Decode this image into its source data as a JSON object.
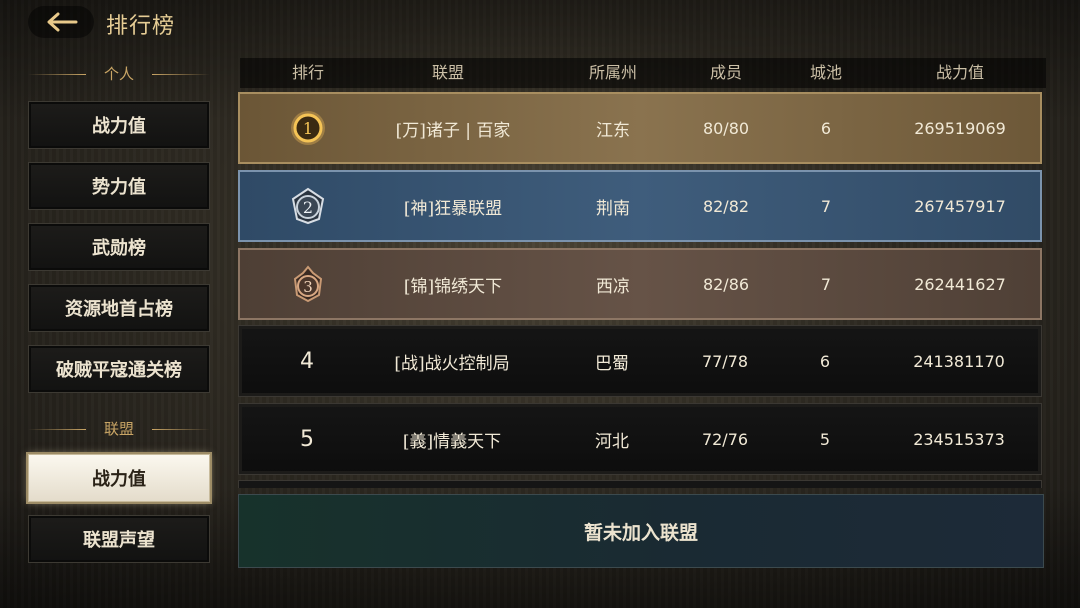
{
  "header": {
    "title": "排行榜"
  },
  "sidebar": {
    "personal_label": "个人",
    "personal_items": [
      "战力值",
      "势力值",
      "武勋榜",
      "资源地首占榜",
      "破贼平寇通关榜"
    ],
    "alliance_label": "联盟",
    "alliance_items": [
      "战力值",
      "联盟声望"
    ],
    "active_item": "联盟-战力值"
  },
  "table": {
    "headers": [
      "排行",
      "联盟",
      "所属州",
      "成员",
      "城池",
      "战力值"
    ],
    "rows": [
      {
        "rank": "1",
        "alliance": "[万]诸子 | 百家",
        "state": "江东",
        "members": "80/80",
        "cities": "6",
        "power": "269519069"
      },
      {
        "rank": "2",
        "alliance": "[神]狂暴联盟",
        "state": "荆南",
        "members": "82/82",
        "cities": "7",
        "power": "267457917"
      },
      {
        "rank": "3",
        "alliance": "[锦]锦绣天下",
        "state": "西凉",
        "members": "82/86",
        "cities": "7",
        "power": "262441627"
      },
      {
        "rank": "4",
        "alliance": "[战]战火控制局",
        "state": "巴蜀",
        "members": "77/78",
        "cities": "6",
        "power": "241381170"
      },
      {
        "rank": "5",
        "alliance": "[義]情義天下",
        "state": "河北",
        "members": "72/76",
        "cities": "5",
        "power": "234515373"
      }
    ]
  },
  "footer": {
    "status": "暂未加入联盟"
  },
  "icons": {
    "back": "back-arrow-icon",
    "rank1": "gold-medal-icon",
    "rank2": "silver-medal-icon",
    "rank3": "bronze-medal-icon"
  },
  "colors": {
    "gold_text": "#e6cd95",
    "rank1": "#8a734f",
    "rank2": "#3f5d7c",
    "rank3": "#665347"
  }
}
